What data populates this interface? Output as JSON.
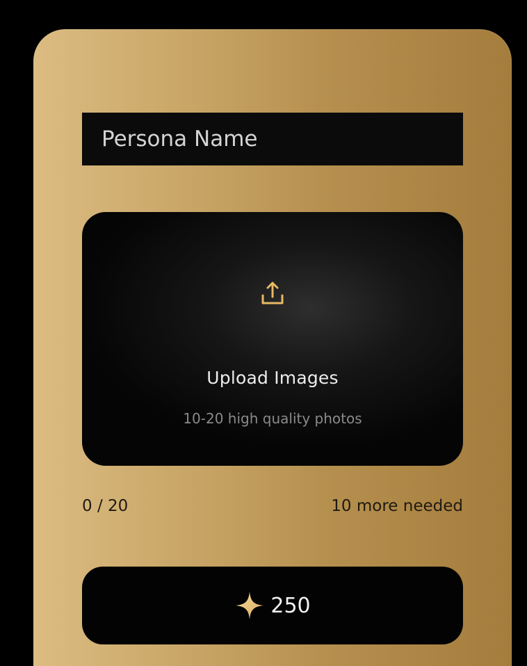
{
  "form": {
    "name_placeholder": "Persona Name",
    "name_value": ""
  },
  "upload": {
    "icon": "upload-icon",
    "title": "Upload Images",
    "subtitle": "10-20 high quality photos"
  },
  "progress": {
    "count_text": "0 / 20",
    "remaining_text": "10 more needed",
    "current": 0,
    "max": 20
  },
  "cta": {
    "icon": "sparkle-icon",
    "cost": "250"
  },
  "colors": {
    "background": "#000000",
    "card_gradient_start": "#dcbc82",
    "card_gradient_end": "#a47d3d",
    "accent_gold": "#e7b864",
    "panel_dark": "#0b0b0b"
  }
}
